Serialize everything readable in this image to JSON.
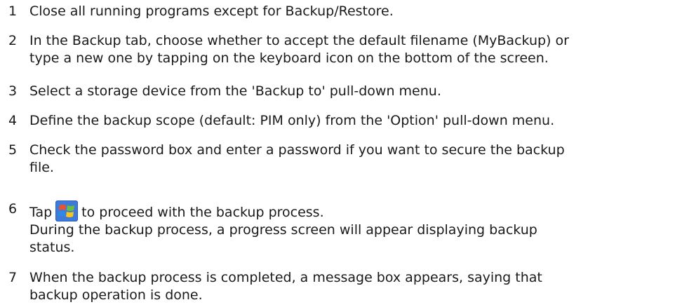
{
  "steps": [
    {
      "num": "1",
      "lines": [
        "Close all running programs except for Backup/Restore."
      ]
    },
    {
      "num": "2",
      "lines": [
        "In the Backup tab, choose whether to accept the default filename (MyBackup) or",
        "type a new one by tapping on the keyboard icon on the bottom of the screen."
      ]
    },
    {
      "num": "3",
      "lines": [
        "Select a storage device from the 'Backup to' pull-down menu."
      ]
    },
    {
      "num": "4",
      "lines": [
        "Define the backup scope (default: PIM only) from the 'Option' pull-down menu."
      ]
    },
    {
      "num": "5",
      "lines": [
        "Check the password box and enter a password if you want to secure the backup",
        "file."
      ]
    },
    {
      "num": "6",
      "pre": "Tap",
      "icon": "windows-start-icon",
      "post": "to proceed with the backup process.",
      "lines": [
        "During the backup process, a progress screen will appear displaying backup",
        "status."
      ]
    },
    {
      "num": "7",
      "lines": [
        "When the backup process is completed, a message box appears, saying that",
        "backup operation is done."
      ]
    }
  ]
}
